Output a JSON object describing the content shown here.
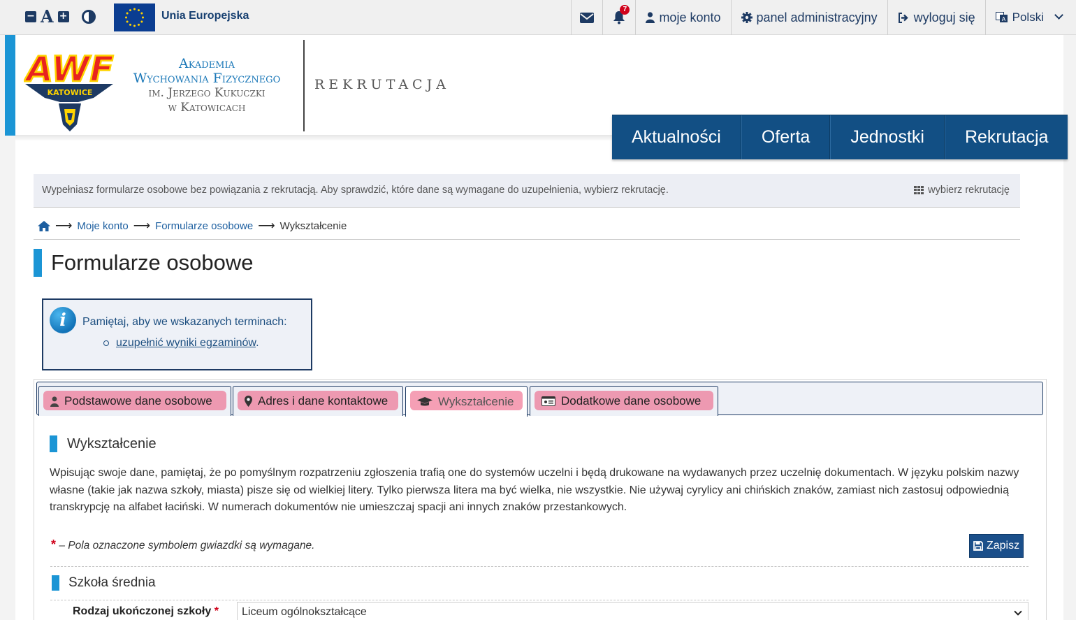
{
  "topbar": {
    "eu_label": "Unia Europejska",
    "notifications_count": "7",
    "nav": [
      {
        "label": "moje konto"
      },
      {
        "label": "panel administracyjny"
      },
      {
        "label": "wyloguj się"
      },
      {
        "label": "Polski"
      }
    ]
  },
  "header": {
    "logo_text": "AWF",
    "logo_sub": "KATOWICE",
    "academy_lines": [
      "Akademia",
      "Wychowania Fizycznego",
      "im. Jerzego Kukuczki",
      "w Katowicach"
    ],
    "section_word": "REKRUTACJA",
    "main_nav": [
      "Aktualności",
      "Oferta",
      "Jednostki",
      "Rekrutacja"
    ]
  },
  "notice": {
    "text": "Wypełniasz formularze osobowe bez powiązania z rekrutacją. Aby sprawdzić, które dane są wymagane do uzupełnienia, wybierz rekrutację.",
    "link": "wybierz rekrutację"
  },
  "breadcrumb": {
    "items": [
      "Moje konto",
      "Formularze osobowe"
    ],
    "current": "Wykształcenie"
  },
  "page_title": "Formularze osobowe",
  "infobox": {
    "text": "Pamiętaj, aby we wskazanych terminach:",
    "link": "uzupełnić wyniki egzaminów",
    "suffix": "."
  },
  "tabs": [
    {
      "label": "Podstawowe dane osobowe",
      "icon": "user-icon"
    },
    {
      "label": "Adres i dane kontaktowe",
      "icon": "map-marker-icon"
    },
    {
      "label": "Wykształcenie",
      "icon": "graduation-cap-icon",
      "active": true
    },
    {
      "label": "Dodatkowe dane osobowe",
      "icon": "id-card-icon"
    }
  ],
  "section": {
    "title": "Wykształcenie",
    "paragraph": "Wpisując swoje dane, pamiętaj, że po pomyślnym rozpatrzeniu zgłoszenia trafią one do systemów uczelni i będą drukowane na wydawanych przez uczelnię dokumentach. W języku polskim nazwy własne (takie jak nazwa szkoły, miasta) pisze się od wielkiej litery. Tylko pierwsza litera ma być wielka, nie wszystkie. Nie używaj cyrylicy ani chińskich znaków, zamiast nich zastosuj odpowiednią transkrypcję na alfabet łaciński. W numerach dokumentów nie umieszczaj spacji ani innych znaków przestankowych.",
    "required_star": "*",
    "required_text": "– Pola oznaczone symbolem gwiazdki są wymagane.",
    "save_label": "Zapisz",
    "subsection": "Szkoła średnia",
    "field_label": "Rodzaj ukończonej szkoły",
    "field_star": "*",
    "field_value": "Liceum ogólnokształcące"
  },
  "colors": {
    "navy": "#1d3a63",
    "accent_blue": "#1b95d5",
    "nav_blue": "#124f84",
    "highlight": "#ec5078"
  }
}
